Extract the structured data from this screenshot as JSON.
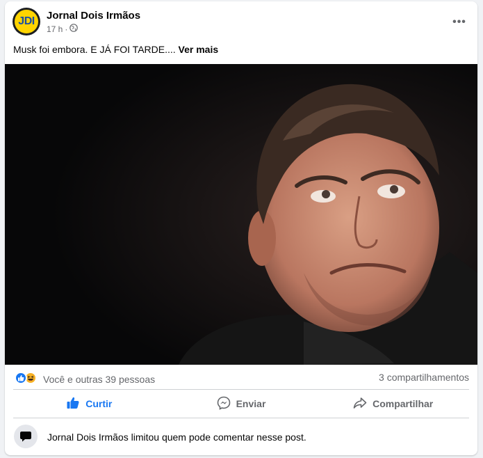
{
  "post": {
    "page_name": "Jornal Dois Irmãos",
    "avatar_text": "JDI",
    "time": "17 h",
    "privacy_icon": "globe-icon",
    "caption": "Musk foi embora. E JÁ FOI TARDE....",
    "see_more": "Ver mais",
    "more_icon": "•••"
  },
  "reactions": {
    "icons": [
      "like-reaction-icon",
      "haha-reaction-icon"
    ],
    "summary": "Você e outras 39 pessoas",
    "shares": "3 compartilhamentos"
  },
  "actions": {
    "like": "Curtir",
    "send": "Enviar",
    "share": "Compartilhar"
  },
  "comments_notice": "Jornal Dois Irmãos limitou quem pode comentar nesse post.",
  "colors": {
    "accent": "#1877f2",
    "secondary_text": "#65676b",
    "avatar_yellow": "#ffd400",
    "avatar_blue": "#1a4fa0"
  }
}
